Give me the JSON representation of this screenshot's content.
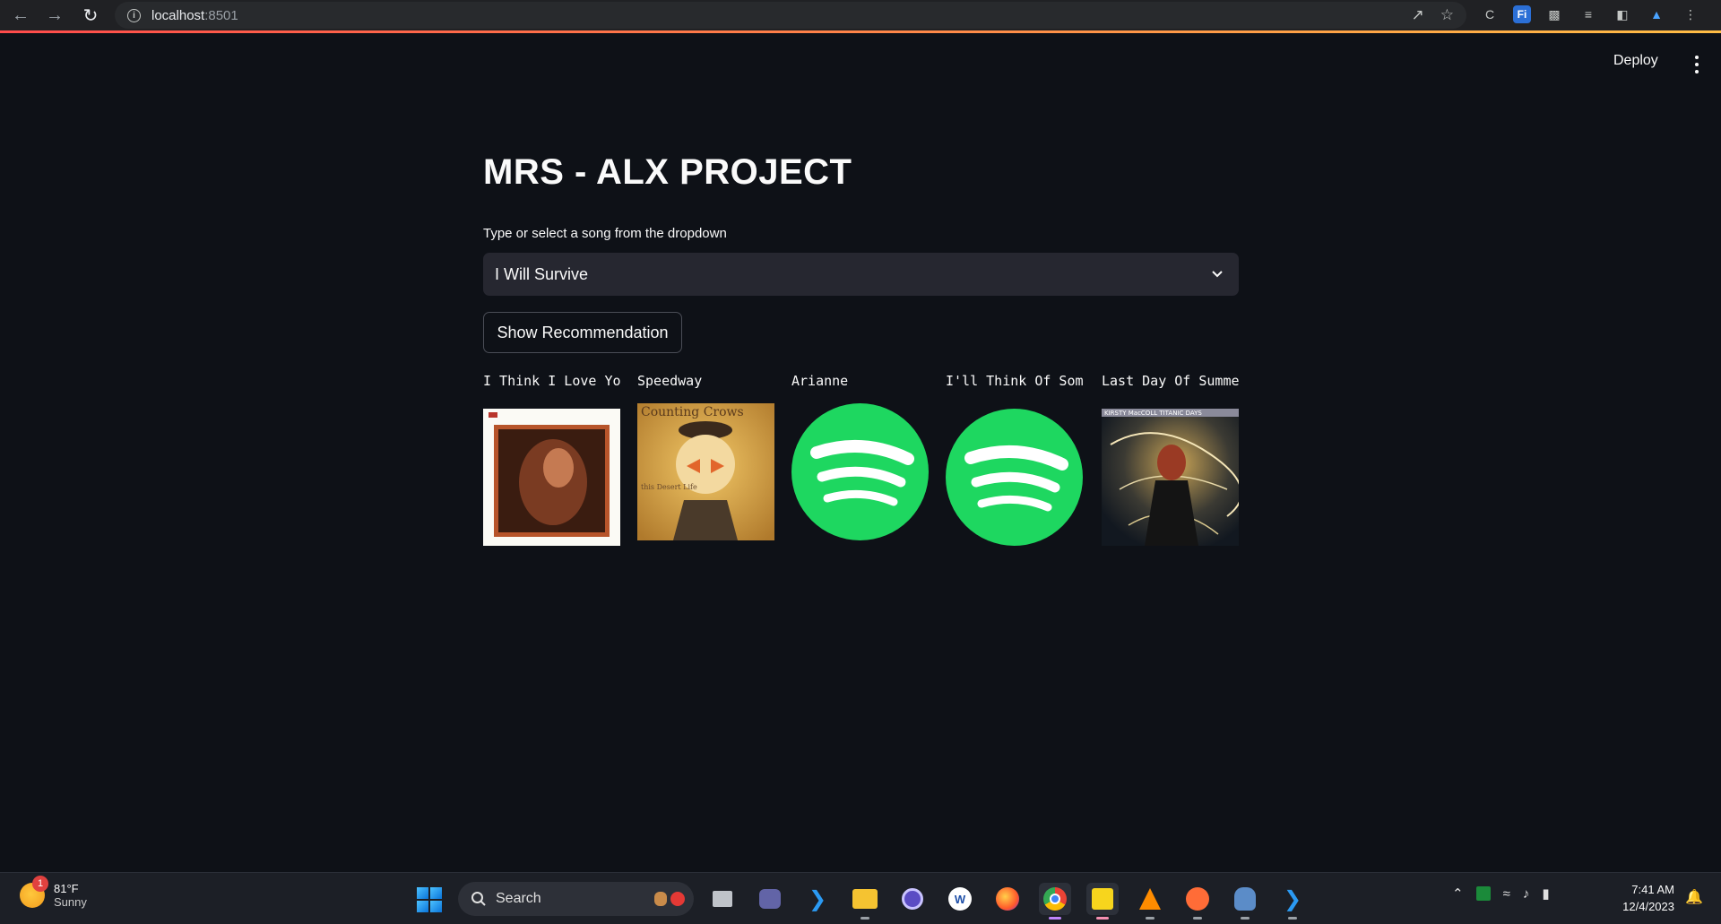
{
  "browser": {
    "url_host": "localhost",
    "url_port": ":8501"
  },
  "app_header": {
    "deploy_label": "Deploy"
  },
  "main": {
    "title": "MRS - ALX PROJECT",
    "select_label": "Type or select a song from the dropdown",
    "selected_song": "I Will Survive",
    "button_label": "Show Recommendation"
  },
  "recommendations": [
    {
      "title": "I Think I Love You",
      "cover": "album-cover"
    },
    {
      "title": "Speedway",
      "cover": "album-cover"
    },
    {
      "title": "Arianne",
      "cover": "spotify-logo"
    },
    {
      "title": "I'll Think Of Something",
      "cover": "spotify-logo"
    },
    {
      "title": "Last Day Of Summer",
      "cover": "album-cover"
    }
  ],
  "covers": {
    "c2_text_top": "Counting Crows",
    "c2_text_bottom": "this Desert Life",
    "c5_text": "KIRSTY MacCOLL  TITANIC DAYS"
  },
  "taskbar": {
    "weather_temp": "81°F",
    "weather_cond": "Sunny",
    "weather_badge": "1",
    "search_label": "Search",
    "time": "7:41 AM",
    "date": "12/4/2023"
  }
}
